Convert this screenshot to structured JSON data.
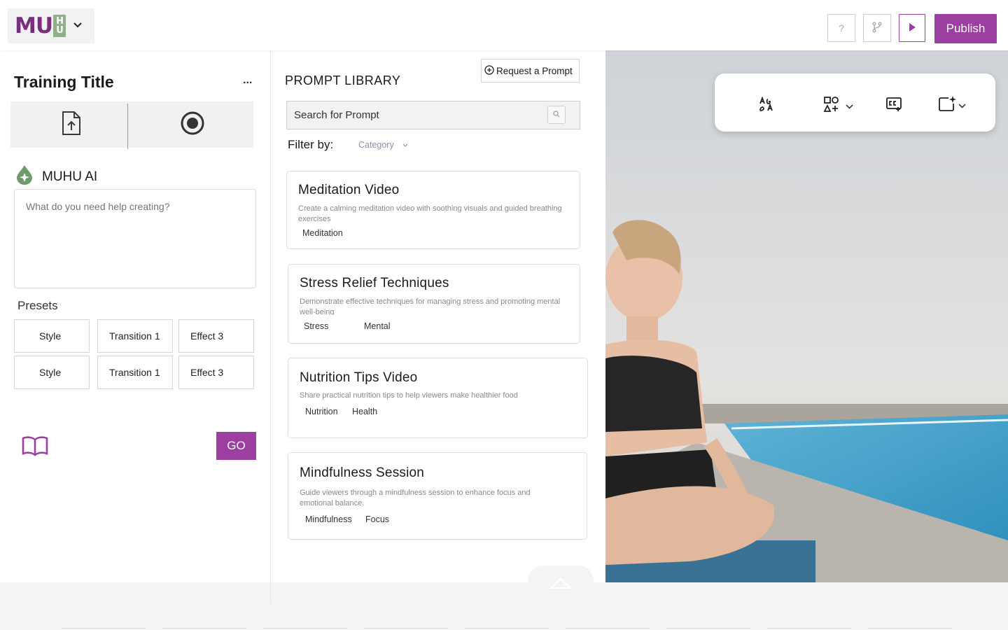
{
  "topbar": {
    "logo_text": "MU",
    "logo_h_top": "H",
    "logo_h_bottom": "U",
    "help_label": "?",
    "publish_label": "Publish"
  },
  "left": {
    "title": "Training Title",
    "more_label": "...",
    "ai_label": "MUHU AI",
    "ai_prompt": "What do you need help creating?",
    "presets_label": "Presets",
    "presets": [
      {
        "label": "Style"
      },
      {
        "label": "Transition 1"
      },
      {
        "label": "Effect 3"
      },
      {
        "label": "Style"
      },
      {
        "label": "Transition 1"
      },
      {
        "label": "Effect 3"
      }
    ],
    "go_label": "GO"
  },
  "library": {
    "title": "PROMPT LIBRARY",
    "request_label": "Request a Prompt",
    "search_placeholder": "Search for Prompt",
    "filter_label": "Filter by:",
    "category_label": "Category",
    "cards": [
      {
        "title": "Meditation Video",
        "desc": "Create a calming meditation video with soothing visuals and guided breathing exercises",
        "tags": [
          "Meditation"
        ]
      },
      {
        "title": "Stress Relief Techniques",
        "desc": "Demonstrate effective techniques for managing stress and promoting mental well-being",
        "tags": [
          "Stress",
          "Mental"
        ]
      },
      {
        "title": "Nutrition Tips Video",
        "desc": "Share practical nutrition tips to help viewers make healthier food",
        "tags": [
          "Nutrition",
          "Health"
        ]
      },
      {
        "title": "Mindfulness Session",
        "desc": "Guide viewers through a mindfulness session to enhance focus and emotional balance.",
        "tags": [
          "Mindfulness",
          "Focus"
        ]
      }
    ]
  },
  "colors": {
    "brand": "#9b3fa0",
    "logo": "#7a2e7e",
    "accent_green": "#8fb08a"
  },
  "icons": [
    "chevron-down-icon",
    "help-icon",
    "branch-icon",
    "play-icon",
    "upload-file-icon",
    "record-icon",
    "ai-drop-icon",
    "book-icon",
    "plus-circle-icon",
    "search-icon",
    "text-style-icon",
    "shapes-icon",
    "captions-icon",
    "ai-frame-icon",
    "chevron-up-icon"
  ]
}
